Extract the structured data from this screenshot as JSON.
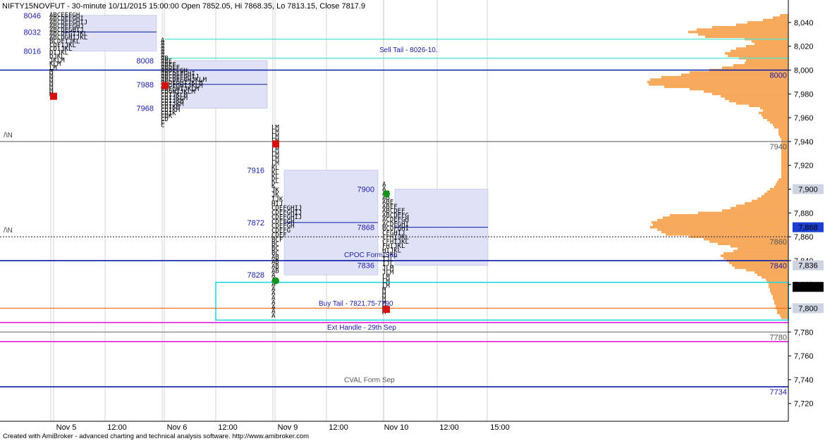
{
  "header": {
    "title": "NIFTY15NOVFUT - 30-minute 10/11/2015 15:00:00 Open 7852.05, Hi 7868.35, Lo 7813.15, Close 7817.9"
  },
  "footer": {
    "text": "Created with AmiBroker - advanced charting and technical analysis software. http://www.amibroker.com"
  },
  "colors": {
    "profile": "#f7a95c",
    "value_area": "#dfe2f7",
    "poc": "#0a1aa8",
    "sell_tail": "#53e5d2",
    "buy_tail": "#21d9e5",
    "handle": "#e31fd9",
    "buy_line": "#f2711c",
    "grid": "#b8b8b8",
    "tpo_red": "#d41010",
    "tpo_green": "#14961e",
    "price_text": "#1a1aa8",
    "level_text": "#555555"
  },
  "chart_data": {
    "type": "market-profile",
    "title": "NIFTY15NOVFUT - 30-minute 10/11/2015 15:00:00 Open 7852.05, Hi 7868.35, Lo 7813.15, Close 7817.9",
    "ylim": [
      7700,
      8050
    ],
    "y_ticks": [
      8040,
      8020,
      8000,
      7980,
      7960,
      7940,
      7920,
      7900,
      7880,
      7860,
      7840,
      7820,
      7800,
      7780,
      7760,
      7740,
      7720
    ],
    "y_tick_labels": [
      "8,040",
      "8,020",
      "8,000",
      "7,980",
      "7,960",
      "7,940",
      "7,920",
      "7,900",
      "7,880",
      "7,860",
      "7,840",
      "7,820",
      "7,800",
      "7,780",
      "7,760",
      "7,740",
      "7,720"
    ],
    "x_ticks": [
      "Nov 5",
      "12:00",
      "Nov 6",
      "12:00",
      "Nov 9",
      "12:00",
      "Nov 10",
      "12:00",
      "15:00"
    ],
    "ohlc": {
      "open": 7852.05,
      "high": 7868.35,
      "low": 7813.15,
      "close": 7817.9
    },
    "axis_badges": [
      {
        "label": "7,900",
        "value": 7900,
        "style": "gray"
      },
      {
        "label": "7,868",
        "value": 7868,
        "style": "blue"
      },
      {
        "label": "7,836",
        "value": 7836,
        "style": "gray"
      },
      {
        "label": "7,817.9",
        "value": 7817.9,
        "style": "black"
      },
      {
        "label": "7,800",
        "value": 7800,
        "style": "gray"
      }
    ],
    "sessions": [
      {
        "date": "Nov 5",
        "vah": 8046,
        "poc": 8032,
        "val": 8016,
        "high": 8048,
        "low": 7978,
        "open_marker": 7978,
        "open_color": "red",
        "labels": [
          {
            "text": "8046",
            "value": 8046
          },
          {
            "text": "8032",
            "value": 8032
          },
          {
            "text": "8016",
            "value": 8016
          }
        ],
        "tpo_rows": [
          "ABCEEFGH",
          "ABCDEFGHI",
          "ABCDEFGHIJ",
          "ABCDEFGHJ",
          "ABCDFGHIJ",
          "ABCDFGIJKL",
          "ABCDGHIJKL",
          "BCDFIJKL",
          "CDFIJKL",
          "CDIJKL",
          "DIJKL",
          "DJKL",
          "JKLM",
          "KLM",
          "LM",
          "M",
          "M",
          "M",
          "M",
          "M",
          "M",
          "M"
        ]
      },
      {
        "date": "Nov 6",
        "vah": 8008,
        "poc": 7988,
        "val": 7968,
        "high": 8026,
        "low": 7952,
        "open_marker": 7987,
        "open_color": "red",
        "labels": [
          {
            "text": "8008",
            "value": 8008
          },
          {
            "text": "7988",
            "value": 7988
          },
          {
            "text": "7968",
            "value": 7968
          }
        ],
        "tpo_rows": [
          "A",
          "A",
          "A",
          "A",
          "A",
          "A",
          "AB",
          "ABE",
          "ABEF",
          "ABDEF",
          "ABDEFGH",
          "ABCDEFGHI",
          "ABCDEFGHIJ",
          "ABCDEFGHJKLM",
          "ACDEGHIJKLM",
          "ACDEGHIJKLM",
          "CDEGHIJKLM",
          "CDGHIJKLM",
          "CDIJKLM",
          "CDIJKLM",
          "CDIJKM",
          "CDIJKM",
          "CDIKM",
          "CDIKM",
          "CDIK",
          "CDK",
          "CD",
          "C",
          "C"
        ]
      },
      {
        "date": "Nov 9",
        "vah": 7916,
        "poc": 7872,
        "val": 7828,
        "high": 7954,
        "low": 7792,
        "open_marker": 7938,
        "open_color": "red",
        "close_marker": 7823,
        "close_color": "green",
        "labels": [
          {
            "text": "7916",
            "value": 7916
          },
          {
            "text": "7872",
            "value": 7872
          },
          {
            "text": "7828",
            "value": 7828
          }
        ],
        "tpo_rows": [
          "LM",
          "LM",
          "LM",
          "LM",
          "LM",
          "LM",
          "LM",
          "LM",
          "LM",
          "KL",
          "KL",
          "KL",
          "KL",
          "K",
          "JK",
          "JK",
          "IJK",
          "HIJ",
          "CDEFGHIJ",
          "CDEFGHIJ",
          "CDEFGHIJ",
          "CDEFGH",
          "CDEFGH",
          "CDEFG",
          "CDEF",
          "BCF",
          "BC",
          "BC",
          "BC",
          "AB",
          "AB",
          "AB",
          "AB",
          "A",
          "A",
          "A",
          "A",
          "A",
          "A",
          "A",
          "A",
          "A",
          "A"
        ]
      },
      {
        "date": "Nov 10",
        "vah": 7900,
        "poc": 7868,
        "val": 7836,
        "high": 7906,
        "low": 7795,
        "open_marker": 7896,
        "open_color": "green",
        "close_marker": 7799,
        "close_color": "red",
        "labels": [
          {
            "text": "7900",
            "value": 7900
          },
          {
            "text": "7868",
            "value": 7868
          },
          {
            "text": "7836",
            "value": 7836
          }
        ],
        "tpo_rows": [
          "A",
          "A",
          "AB",
          "AB",
          "ABE",
          "ABEF",
          "ABCDEF",
          "ABCDEFG",
          "ACDEFGH",
          "ACDFGHI",
          "BCDFGHI",
          "CFGHIJ",
          "CFHIJKL",
          "CFHIJKL",
          "FHIJKL",
          "HIJKL",
          "IJKL",
          "IJL",
          "IJL",
          "JLM",
          "JLM",
          "LM",
          "LM",
          "LM",
          "M",
          "M",
          "M",
          "M",
          "M",
          "M"
        ]
      }
    ],
    "lines": [
      {
        "label": "Sell Tail - 8026-10.",
        "type": "band",
        "top": 8026,
        "bottom": 8010,
        "from_session": 1,
        "color": "sell_tail"
      },
      {
        "label": "Buy Tail - 7821.75-7790",
        "type": "box",
        "top": 7821.75,
        "bottom": 7790,
        "from_session": 2,
        "color": "buy_tail"
      },
      {
        "label": "Ext Handle - 29th Sep",
        "type": "pair",
        "values": [
          7788,
          7772
        ],
        "color": "handle"
      },
      {
        "label": "CVAL Form Sep",
        "type": "line",
        "value": 7734,
        "right_label": "7734",
        "color": "poc"
      },
      {
        "label": "CPOC Form Sep",
        "type": "line",
        "value": 7840,
        "right_label": "7840",
        "color": "poc"
      },
      {
        "label": "",
        "type": "line",
        "value": 8000,
        "right_label": "8000",
        "color": "poc"
      },
      {
        "label": "",
        "type": "line",
        "value": 7940,
        "right_label": "7940",
        "left_label": "/\\N",
        "color": "gray"
      },
      {
        "label": "",
        "type": "dotted",
        "value": 7860,
        "right_label": "7860",
        "left_label": "/\\N",
        "color": "dark"
      },
      {
        "label": "",
        "type": "line",
        "value": 7780,
        "right_label": "7780",
        "color": "gray"
      },
      {
        "label": "",
        "type": "line",
        "value": 7800,
        "right_label": "",
        "color": "buy_line"
      }
    ],
    "volume_profile": [
      {
        "price": 8046,
        "width": 12
      },
      {
        "price": 8044,
        "width": 22
      },
      {
        "price": 8042,
        "width": 36
      },
      {
        "price": 8040,
        "width": 58
      },
      {
        "price": 8038,
        "width": 74
      },
      {
        "price": 8036,
        "width": 108
      },
      {
        "price": 8034,
        "width": 130
      },
      {
        "price": 8032,
        "width": 142
      },
      {
        "price": 8030,
        "width": 128
      },
      {
        "price": 8028,
        "width": 118
      },
      {
        "price": 8026,
        "width": 62
      },
      {
        "price": 8024,
        "width": 52
      },
      {
        "price": 8022,
        "width": 48
      },
      {
        "price": 8020,
        "width": 60
      },
      {
        "price": 8018,
        "width": 74
      },
      {
        "price": 8016,
        "width": 82
      },
      {
        "price": 8014,
        "width": 90
      },
      {
        "price": 8012,
        "width": 86
      },
      {
        "price": 8010,
        "width": 70
      },
      {
        "price": 8008,
        "width": 60
      },
      {
        "price": 8006,
        "width": 62
      },
      {
        "price": 8004,
        "width": 78
      },
      {
        "price": 8002,
        "width": 94
      },
      {
        "price": 8000,
        "width": 112
      },
      {
        "price": 7998,
        "width": 140
      },
      {
        "price": 7996,
        "width": 152
      },
      {
        "price": 7994,
        "width": 180
      },
      {
        "price": 7992,
        "width": 196
      },
      {
        "price": 7990,
        "width": 200
      },
      {
        "price": 7988,
        "width": 198
      },
      {
        "price": 7986,
        "width": 176
      },
      {
        "price": 7984,
        "width": 140
      },
      {
        "price": 7982,
        "width": 120
      },
      {
        "price": 7980,
        "width": 108
      },
      {
        "price": 7978,
        "width": 96
      },
      {
        "price": 7976,
        "width": 90
      },
      {
        "price": 7974,
        "width": 84
      },
      {
        "price": 7972,
        "width": 74
      },
      {
        "price": 7970,
        "width": 56
      },
      {
        "price": 7968,
        "width": 40
      },
      {
        "price": 7966,
        "width": 36
      },
      {
        "price": 7964,
        "width": 42
      },
      {
        "price": 7962,
        "width": 38
      },
      {
        "price": 7960,
        "width": 36
      },
      {
        "price": 7958,
        "width": 30
      },
      {
        "price": 7956,
        "width": 26
      },
      {
        "price": 7954,
        "width": 22
      },
      {
        "price": 7952,
        "width": 20
      },
      {
        "price": 7950,
        "width": 14
      },
      {
        "price": 7948,
        "width": 14
      },
      {
        "price": 7946,
        "width": 14
      },
      {
        "price": 7944,
        "width": 12
      },
      {
        "price": 7942,
        "width": 10
      },
      {
        "price": 7940,
        "width": 10
      },
      {
        "price": 7938,
        "width": 10
      },
      {
        "price": 7936,
        "width": 10
      },
      {
        "price": 7934,
        "width": 10
      },
      {
        "price": 7932,
        "width": 10
      },
      {
        "price": 7930,
        "width": 10
      },
      {
        "price": 7928,
        "width": 10
      },
      {
        "price": 7926,
        "width": 10
      },
      {
        "price": 7924,
        "width": 10
      },
      {
        "price": 7922,
        "width": 10
      },
      {
        "price": 7920,
        "width": 10
      },
      {
        "price": 7918,
        "width": 10
      },
      {
        "price": 7916,
        "width": 10
      },
      {
        "price": 7914,
        "width": 10
      },
      {
        "price": 7912,
        "width": 10
      },
      {
        "price": 7910,
        "width": 10
      },
      {
        "price": 7908,
        "width": 14
      },
      {
        "price": 7906,
        "width": 16
      },
      {
        "price": 7904,
        "width": 18
      },
      {
        "price": 7902,
        "width": 20
      },
      {
        "price": 7900,
        "width": 26
      },
      {
        "price": 7898,
        "width": 30
      },
      {
        "price": 7896,
        "width": 34
      },
      {
        "price": 7894,
        "width": 38
      },
      {
        "price": 7892,
        "width": 44
      },
      {
        "price": 7890,
        "width": 52
      },
      {
        "price": 7888,
        "width": 62
      },
      {
        "price": 7886,
        "width": 74
      },
      {
        "price": 7884,
        "width": 82
      },
      {
        "price": 7882,
        "width": 94
      },
      {
        "price": 7880,
        "width": 128
      },
      {
        "price": 7878,
        "width": 168
      },
      {
        "price": 7876,
        "width": 178
      },
      {
        "price": 7874,
        "width": 186
      },
      {
        "price": 7872,
        "width": 194
      },
      {
        "price": 7870,
        "width": 192
      },
      {
        "price": 7868,
        "width": 196
      },
      {
        "price": 7866,
        "width": 186
      },
      {
        "price": 7864,
        "width": 180
      },
      {
        "price": 7862,
        "width": 174
      },
      {
        "price": 7860,
        "width": 140
      },
      {
        "price": 7858,
        "width": 120
      },
      {
        "price": 7856,
        "width": 112
      },
      {
        "price": 7854,
        "width": 100
      },
      {
        "price": 7852,
        "width": 82
      },
      {
        "price": 7850,
        "width": 72
      },
      {
        "price": 7848,
        "width": 78
      },
      {
        "price": 7846,
        "width": 92
      },
      {
        "price": 7844,
        "width": 96
      },
      {
        "price": 7842,
        "width": 92
      },
      {
        "price": 7840,
        "width": 88
      },
      {
        "price": 7838,
        "width": 84
      },
      {
        "price": 7836,
        "width": 80
      },
      {
        "price": 7834,
        "width": 76
      },
      {
        "price": 7832,
        "width": 60
      },
      {
        "price": 7830,
        "width": 48
      },
      {
        "price": 7828,
        "width": 44
      },
      {
        "price": 7826,
        "width": 38
      },
      {
        "price": 7824,
        "width": 32
      },
      {
        "price": 7822,
        "width": 30
      },
      {
        "price": 7820,
        "width": 28
      },
      {
        "price": 7818,
        "width": 28
      },
      {
        "price": 7816,
        "width": 26
      },
      {
        "price": 7814,
        "width": 26
      },
      {
        "price": 7812,
        "width": 24
      },
      {
        "price": 7810,
        "width": 22
      },
      {
        "price": 7808,
        "width": 22
      },
      {
        "price": 7806,
        "width": 20
      },
      {
        "price": 7804,
        "width": 20
      },
      {
        "price": 7802,
        "width": 18
      },
      {
        "price": 7800,
        "width": 18
      },
      {
        "price": 7798,
        "width": 16
      },
      {
        "price": 7796,
        "width": 16
      },
      {
        "price": 7794,
        "width": 12
      },
      {
        "price": 7792,
        "width": 10
      }
    ]
  }
}
